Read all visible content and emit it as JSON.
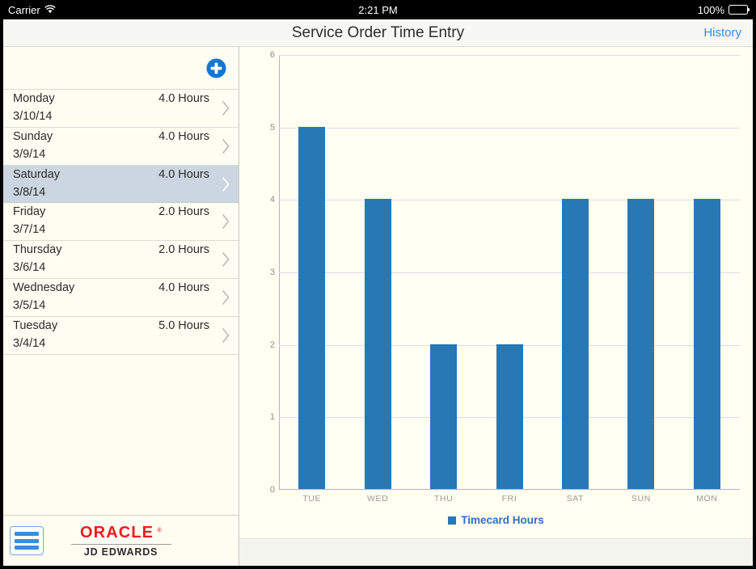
{
  "status_bar": {
    "carrier": "Carrier",
    "wifi_icon": "wifi-icon",
    "time": "2:21 PM",
    "battery_percent": "100%",
    "battery_icon": "battery-full-icon"
  },
  "nav": {
    "title": "Service Order Time Entry",
    "history_label": "History"
  },
  "list": {
    "add_icon": "plus-circle-icon",
    "rows": [
      {
        "day": "Monday",
        "date": "3/10/14",
        "hours": "4.0 Hours",
        "selected": false
      },
      {
        "day": "Sunday",
        "date": "3/9/14",
        "hours": "4.0 Hours",
        "selected": false
      },
      {
        "day": "Saturday",
        "date": "3/8/14",
        "hours": "4.0 Hours",
        "selected": true
      },
      {
        "day": "Friday",
        "date": "3/7/14",
        "hours": "2.0 Hours",
        "selected": false
      },
      {
        "day": "Thursday",
        "date": "3/6/14",
        "hours": "2.0 Hours",
        "selected": false
      },
      {
        "day": "Wednesday",
        "date": "3/5/14",
        "hours": "4.0 Hours",
        "selected": false
      },
      {
        "day": "Tuesday",
        "date": "3/4/14",
        "hours": "5.0 Hours",
        "selected": false
      }
    ]
  },
  "footer": {
    "menu_icon": "hamburger-menu-icon",
    "brand": "ORACLE",
    "brand_reg": "®",
    "product": "JD EDWARDS"
  },
  "colors": {
    "bar": "#2878b4",
    "accent_link": "#3b8cde",
    "selected_row": "#ccd6e0",
    "oracle_red": "#ec1c24",
    "chart_background": "#fffff2",
    "gridline": "#ded9ea"
  },
  "chart_data": {
    "type": "bar",
    "title": "",
    "xlabel": "",
    "ylabel": "",
    "categories": [
      "TUE",
      "WED",
      "THU",
      "FRI",
      "SAT",
      "SUN",
      "MON"
    ],
    "values": [
      5,
      4,
      2,
      2,
      4,
      4,
      4
    ],
    "ylim": [
      0,
      6
    ],
    "yticks": [
      0,
      1,
      2,
      3,
      4,
      5,
      6
    ],
    "grid": true,
    "legend": {
      "position": "bottom",
      "entries": [
        "Timecard Hours"
      ]
    },
    "series": [
      {
        "name": "Timecard Hours",
        "values": [
          5,
          4,
          2,
          2,
          4,
          4,
          4
        ],
        "color": "#2878b4"
      }
    ]
  }
}
